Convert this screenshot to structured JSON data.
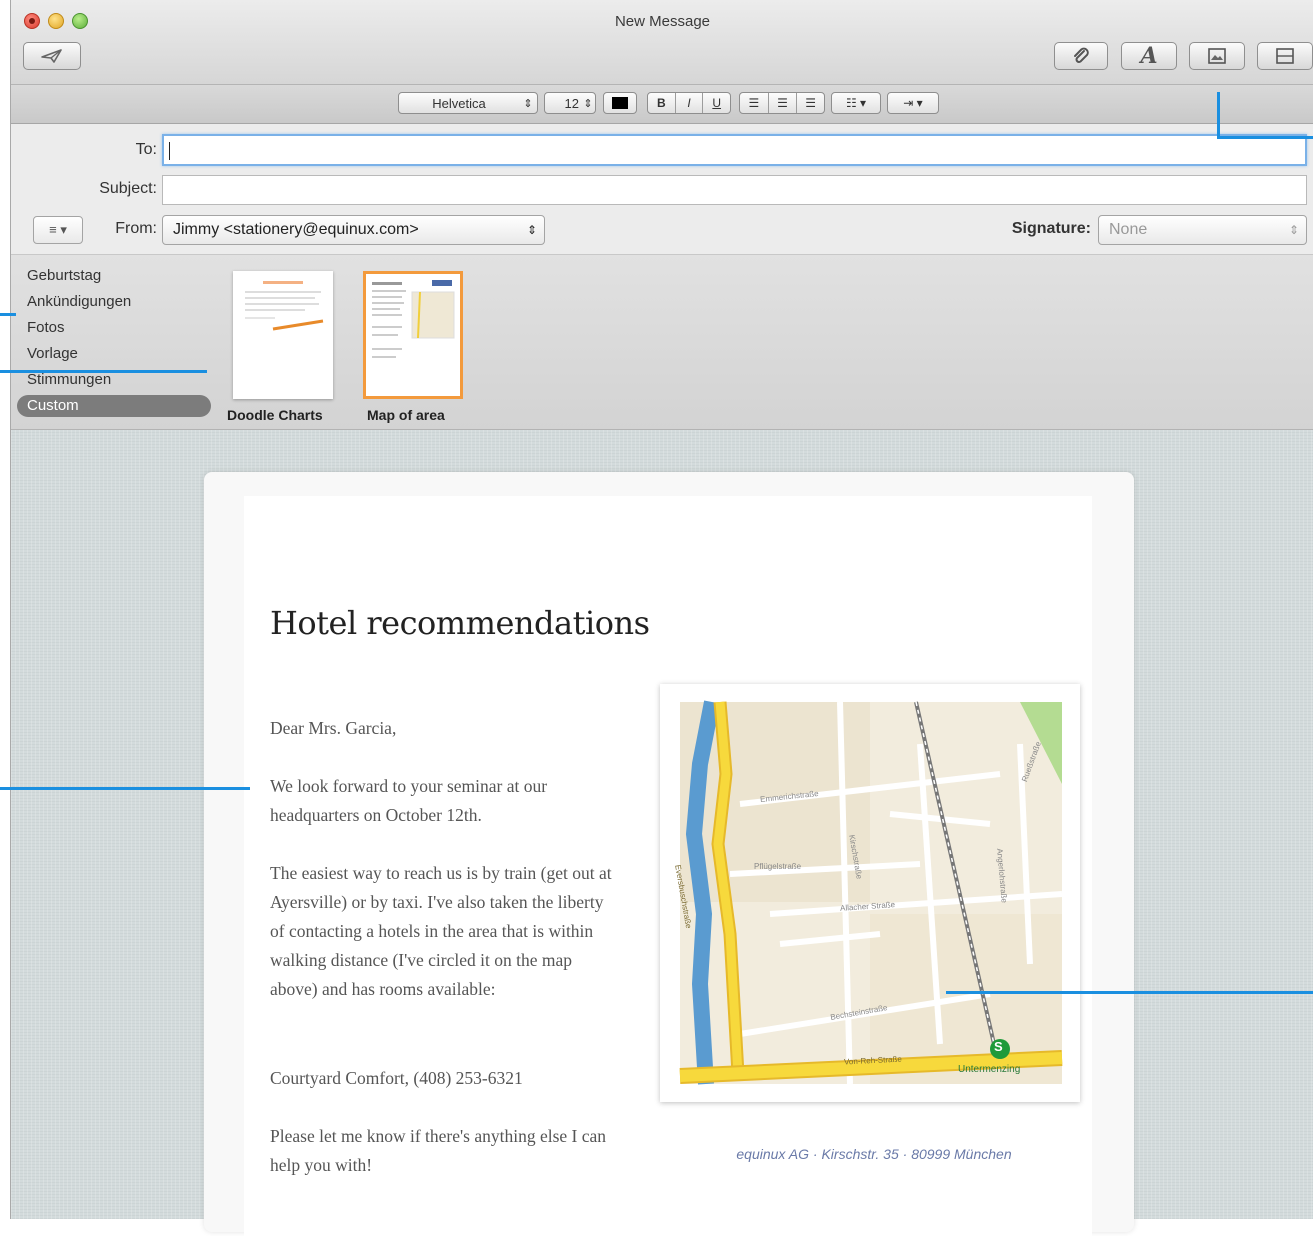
{
  "window": {
    "title": "New Message"
  },
  "format_bar": {
    "font": "Helvetica",
    "size": "12",
    "bold": "B",
    "italic": "I",
    "underline": "U"
  },
  "headers": {
    "to_label": "To:",
    "to_value": "",
    "subject_label": "Subject:",
    "subject_value": "",
    "from_label": "From:",
    "from_value": "Jimmy <stationery@equinux.com>",
    "signature_label": "Signature:",
    "signature_value": "None"
  },
  "stationery": {
    "categories": [
      "Geburtstag",
      "Ankündigungen",
      "Fotos",
      "Vorlage",
      "Stimmungen",
      "Custom"
    ],
    "selected_category": "Custom",
    "templates": [
      {
        "label": "Doodle Charts"
      },
      {
        "label": "Map of area",
        "selected": true
      }
    ]
  },
  "message": {
    "title": "Hotel recommendations",
    "greeting": "Dear Mrs. Garcia,",
    "p1": "We look forward to your seminar at our headquarters on October 12th.",
    "p2": "The easiest way to reach us is by train (get out at Ayersville) or by  taxi. I've also taken the liberty of contacting a hotels in the area that is within walking distance (I've circled it on the map above) and has rooms available:",
    "hotel": "Courtyard Comfort, (408) 253-6321",
    "p3": "Please let me know if there's anything else I can help you with!",
    "map_caption": "equinux AG · Kirschstr. 35 · 80999 München"
  },
  "map": {
    "streets": [
      "Eversbuschstraße",
      "Emmerichstraße",
      "Kirschstraße",
      "Pflügelstraße",
      "Allacher Straße",
      "Bechsteinstraße",
      "Von-Reh-Straße",
      "Angerlohstraße",
      "Rueßstraße"
    ],
    "station_letter": "S",
    "station_name": "Untermenzing"
  },
  "colors": {
    "accent": "#1a8fe0",
    "selected_template_border": "#f39a3c"
  }
}
